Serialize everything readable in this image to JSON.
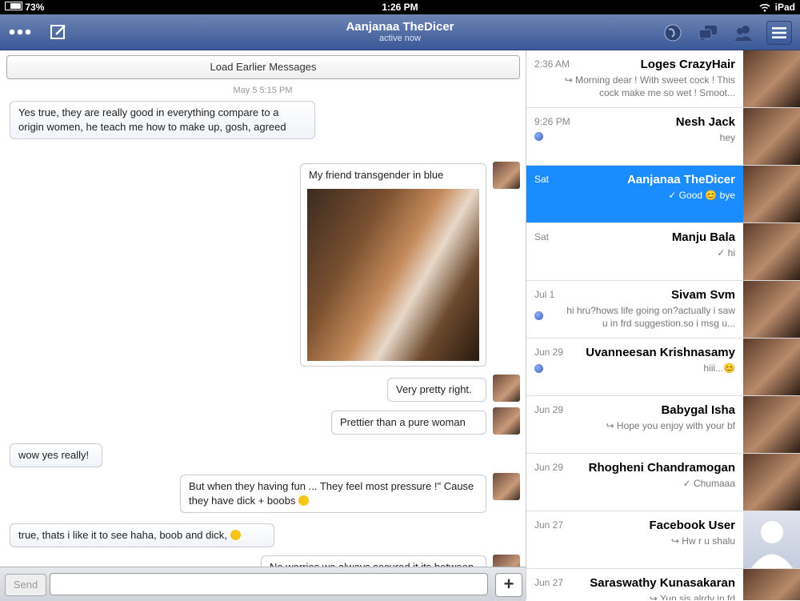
{
  "status": {
    "device": "iPad",
    "time": "1:26 PM",
    "battery": "73%"
  },
  "nav": {
    "title": "Aanjanaa TheDicer",
    "subtitle": "active now"
  },
  "chat": {
    "load_earlier": "Load Earlier Messages",
    "timestamp": "May 5 5:15 PM",
    "messages": [
      {
        "side": "left",
        "text": "Yes true, they are really good in everything compare to a origin women, he teach me how to make up, gosh, agreed"
      },
      {
        "side": "right",
        "text": "My friend transgender in blue"
      },
      {
        "side": "right",
        "text": "Very pretty right."
      },
      {
        "side": "right",
        "text": "Prettier than a pure woman"
      },
      {
        "side": "left",
        "text": "wow yes really!"
      },
      {
        "side": "right",
        "text": "But when they having fun ... They feel most pressure !\" Cause they have dick + boobs"
      },
      {
        "side": "left",
        "text": "true, thats i like it to see haha, boob and dick,"
      },
      {
        "side": "right",
        "text": "No worries we always secured it its between"
      }
    ]
  },
  "composer": {
    "send_label": "Send",
    "placeholder": "",
    "attach_label": "+"
  },
  "conversations": [
    {
      "name": "Loges CrazyHair",
      "time": "2:36 AM",
      "preview": "↪ Morning dear ! With sweet cock ! This cock make me so wet ! Smoot...",
      "unread": false,
      "selected": false
    },
    {
      "name": "Nesh Jack",
      "time": "9:26 PM",
      "preview": "hey",
      "unread": true,
      "selected": false
    },
    {
      "name": "Aanjanaa TheDicer",
      "time": "Sat",
      "preview": "✓ Good 😊 bye",
      "unread": false,
      "selected": true
    },
    {
      "name": "Manju Bala",
      "time": "Sat",
      "preview": "✓ hi",
      "unread": false,
      "selected": false
    },
    {
      "name": "Sivam Svm",
      "time": "Jul 1",
      "preview": "hi hru?hows life going on?actually i saw u in frd suggestion.so i msg u...",
      "unread": true,
      "selected": false
    },
    {
      "name": "Uvanneesan Krishnasamy",
      "time": "Jun 29",
      "preview": "hiii...😊",
      "unread": true,
      "selected": false
    },
    {
      "name": "Babygal Isha",
      "time": "Jun 29",
      "preview": "↪ Hope you enjoy with your bf",
      "unread": false,
      "selected": false
    },
    {
      "name": "Rhogheni Chandramogan",
      "time": "Jun 29",
      "preview": "✓ Chumaaa",
      "unread": false,
      "selected": false
    },
    {
      "name": "Facebook User",
      "time": "Jun 27",
      "preview": "↪ Hw r u shalu",
      "unread": false,
      "selected": false
    },
    {
      "name": "Saraswathy Kunasakaran",
      "time": "Jun 27",
      "preview": "↪ Yup sis alrdy in fd",
      "unread": false,
      "selected": false
    }
  ]
}
